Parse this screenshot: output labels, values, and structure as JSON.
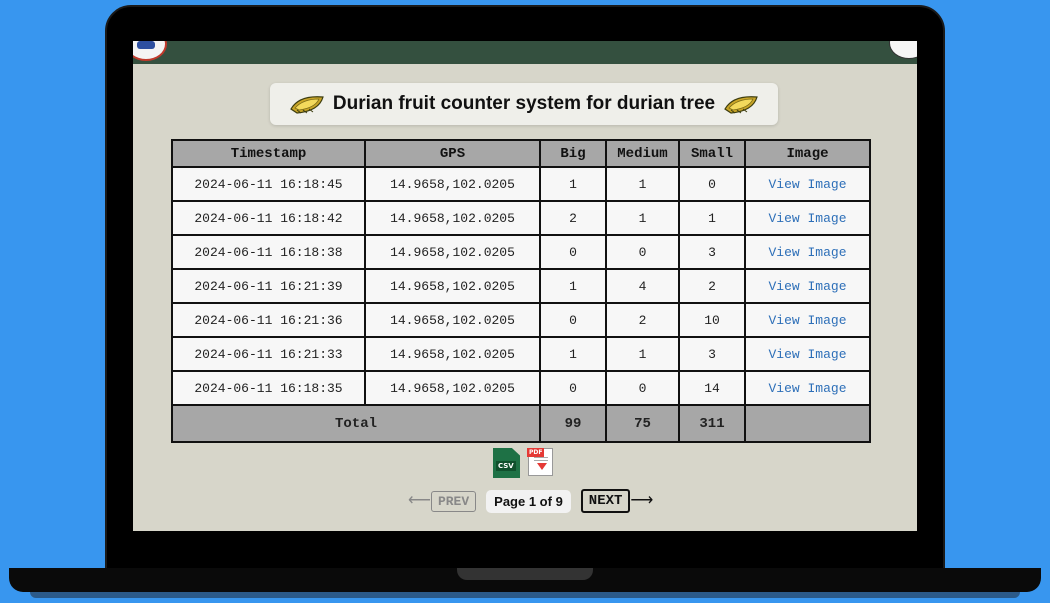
{
  "title": "Durian fruit counter system for durian tree",
  "table": {
    "headers": [
      "Timestamp",
      "GPS",
      "Big",
      "Medium",
      "Small",
      "Image"
    ],
    "rows": [
      [
        "2024-06-11 16:18:45",
        "14.9658,102.0205",
        "1",
        "1",
        "0",
        "View Image"
      ],
      [
        "2024-06-11 16:18:42",
        "14.9658,102.0205",
        "2",
        "1",
        "1",
        "View Image"
      ],
      [
        "2024-06-11 16:18:38",
        "14.9658,102.0205",
        "0",
        "0",
        "3",
        "View Image"
      ],
      [
        "2024-06-11 16:21:39",
        "14.9658,102.0205",
        "1",
        "4",
        "2",
        "View Image"
      ],
      [
        "2024-06-11 16:21:36",
        "14.9658,102.0205",
        "0",
        "2",
        "10",
        "View Image"
      ],
      [
        "2024-06-11 16:21:33",
        "14.9658,102.0205",
        "1",
        "1",
        "3",
        "View Image"
      ],
      [
        "2024-06-11 16:18:35",
        "14.9658,102.0205",
        "0",
        "0",
        "14",
        "View Image"
      ]
    ],
    "total": {
      "label": "Total",
      "big": "99",
      "medium": "75",
      "small": "311"
    }
  },
  "exports": {
    "csv_label": "CSV",
    "pdf_label": "PDF"
  },
  "pagination": {
    "prev_label": "PREV",
    "page_indicator": "Page 1 of 9",
    "next_label": "NEXT"
  },
  "icons": {
    "title_left": "durian-icon",
    "title_right": "durian-icon",
    "csv": "csv-file-icon",
    "pdf": "pdf-download-icon",
    "prev": "arrow-left-icon",
    "next": "arrow-right-icon"
  },
  "colors": {
    "background": "#3896ef",
    "topbar": "#34503f",
    "screen": "#d7d6ca",
    "header_cell": "#a7a7a7",
    "link": "#2d6fb8"
  }
}
